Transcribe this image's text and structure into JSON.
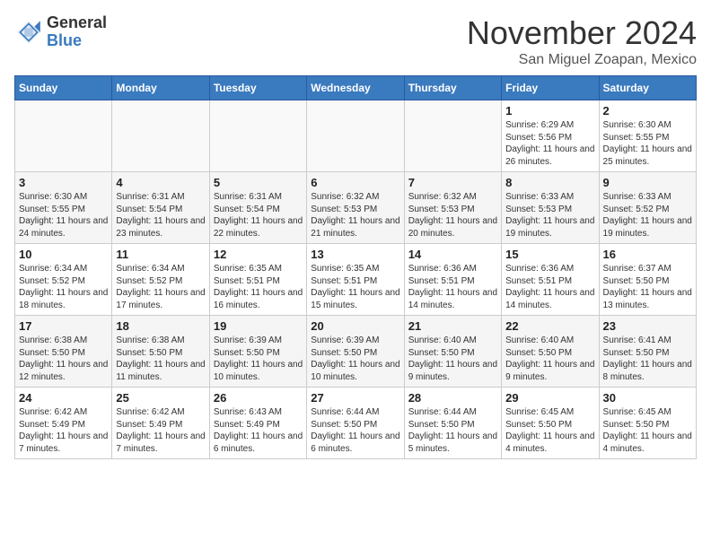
{
  "logo": {
    "general": "General",
    "blue": "Blue"
  },
  "title": "November 2024",
  "subtitle": "San Miguel Zoapan, Mexico",
  "days_of_week": [
    "Sunday",
    "Monday",
    "Tuesday",
    "Wednesday",
    "Thursday",
    "Friday",
    "Saturday"
  ],
  "weeks": [
    [
      {
        "day": "",
        "info": ""
      },
      {
        "day": "",
        "info": ""
      },
      {
        "day": "",
        "info": ""
      },
      {
        "day": "",
        "info": ""
      },
      {
        "day": "",
        "info": ""
      },
      {
        "day": "1",
        "info": "Sunrise: 6:29 AM\nSunset: 5:56 PM\nDaylight: 11 hours and 26 minutes."
      },
      {
        "day": "2",
        "info": "Sunrise: 6:30 AM\nSunset: 5:55 PM\nDaylight: 11 hours and 25 minutes."
      }
    ],
    [
      {
        "day": "3",
        "info": "Sunrise: 6:30 AM\nSunset: 5:55 PM\nDaylight: 11 hours and 24 minutes."
      },
      {
        "day": "4",
        "info": "Sunrise: 6:31 AM\nSunset: 5:54 PM\nDaylight: 11 hours and 23 minutes."
      },
      {
        "day": "5",
        "info": "Sunrise: 6:31 AM\nSunset: 5:54 PM\nDaylight: 11 hours and 22 minutes."
      },
      {
        "day": "6",
        "info": "Sunrise: 6:32 AM\nSunset: 5:53 PM\nDaylight: 11 hours and 21 minutes."
      },
      {
        "day": "7",
        "info": "Sunrise: 6:32 AM\nSunset: 5:53 PM\nDaylight: 11 hours and 20 minutes."
      },
      {
        "day": "8",
        "info": "Sunrise: 6:33 AM\nSunset: 5:53 PM\nDaylight: 11 hours and 19 minutes."
      },
      {
        "day": "9",
        "info": "Sunrise: 6:33 AM\nSunset: 5:52 PM\nDaylight: 11 hours and 19 minutes."
      }
    ],
    [
      {
        "day": "10",
        "info": "Sunrise: 6:34 AM\nSunset: 5:52 PM\nDaylight: 11 hours and 18 minutes."
      },
      {
        "day": "11",
        "info": "Sunrise: 6:34 AM\nSunset: 5:52 PM\nDaylight: 11 hours and 17 minutes."
      },
      {
        "day": "12",
        "info": "Sunrise: 6:35 AM\nSunset: 5:51 PM\nDaylight: 11 hours and 16 minutes."
      },
      {
        "day": "13",
        "info": "Sunrise: 6:35 AM\nSunset: 5:51 PM\nDaylight: 11 hours and 15 minutes."
      },
      {
        "day": "14",
        "info": "Sunrise: 6:36 AM\nSunset: 5:51 PM\nDaylight: 11 hours and 14 minutes."
      },
      {
        "day": "15",
        "info": "Sunrise: 6:36 AM\nSunset: 5:51 PM\nDaylight: 11 hours and 14 minutes."
      },
      {
        "day": "16",
        "info": "Sunrise: 6:37 AM\nSunset: 5:50 PM\nDaylight: 11 hours and 13 minutes."
      }
    ],
    [
      {
        "day": "17",
        "info": "Sunrise: 6:38 AM\nSunset: 5:50 PM\nDaylight: 11 hours and 12 minutes."
      },
      {
        "day": "18",
        "info": "Sunrise: 6:38 AM\nSunset: 5:50 PM\nDaylight: 11 hours and 11 minutes."
      },
      {
        "day": "19",
        "info": "Sunrise: 6:39 AM\nSunset: 5:50 PM\nDaylight: 11 hours and 10 minutes."
      },
      {
        "day": "20",
        "info": "Sunrise: 6:39 AM\nSunset: 5:50 PM\nDaylight: 11 hours and 10 minutes."
      },
      {
        "day": "21",
        "info": "Sunrise: 6:40 AM\nSunset: 5:50 PM\nDaylight: 11 hours and 9 minutes."
      },
      {
        "day": "22",
        "info": "Sunrise: 6:40 AM\nSunset: 5:50 PM\nDaylight: 11 hours and 9 minutes."
      },
      {
        "day": "23",
        "info": "Sunrise: 6:41 AM\nSunset: 5:50 PM\nDaylight: 11 hours and 8 minutes."
      }
    ],
    [
      {
        "day": "24",
        "info": "Sunrise: 6:42 AM\nSunset: 5:49 PM\nDaylight: 11 hours and 7 minutes."
      },
      {
        "day": "25",
        "info": "Sunrise: 6:42 AM\nSunset: 5:49 PM\nDaylight: 11 hours and 7 minutes."
      },
      {
        "day": "26",
        "info": "Sunrise: 6:43 AM\nSunset: 5:49 PM\nDaylight: 11 hours and 6 minutes."
      },
      {
        "day": "27",
        "info": "Sunrise: 6:44 AM\nSunset: 5:50 PM\nDaylight: 11 hours and 6 minutes."
      },
      {
        "day": "28",
        "info": "Sunrise: 6:44 AM\nSunset: 5:50 PM\nDaylight: 11 hours and 5 minutes."
      },
      {
        "day": "29",
        "info": "Sunrise: 6:45 AM\nSunset: 5:50 PM\nDaylight: 11 hours and 4 minutes."
      },
      {
        "day": "30",
        "info": "Sunrise: 6:45 AM\nSunset: 5:50 PM\nDaylight: 11 hours and 4 minutes."
      }
    ]
  ]
}
